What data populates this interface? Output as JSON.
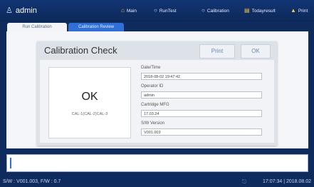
{
  "header": {
    "user": "admin",
    "nav": [
      {
        "label": "Main",
        "icon": "home-icon"
      },
      {
        "label": "RunTest",
        "icon": "runtest-icon"
      },
      {
        "label": "Calibration",
        "icon": "calibration-icon"
      },
      {
        "label": "Todayresult",
        "icon": "todayresult-icon"
      },
      {
        "label": "Print",
        "icon": "printer-icon"
      }
    ]
  },
  "tabs": [
    {
      "label": "Run Calibration",
      "selected": true
    },
    {
      "label": "Calibration Review",
      "selected": false
    }
  ],
  "dialog": {
    "title": "Calibration Check",
    "print_label": "Print",
    "ok_label": "OK",
    "result": "OK",
    "result_detail": "CAL-1(CAL-2)CAL-3",
    "fields": [
      {
        "label": "Date/Time",
        "value": "2018-08-02 19:47:42"
      },
      {
        "label": "Operator ID",
        "value": "admin"
      },
      {
        "label": "Cartridge MFG",
        "value": "17.03.24"
      },
      {
        "label": "S/W Version",
        "value": "V001.003"
      }
    ]
  },
  "footer": {
    "version": "S/W : V001.003, F/W : 0.7",
    "datetime": "17:07:34 | 2018.08.02"
  },
  "colors": {
    "background": "#0f2a5c",
    "accent": "#2f6fd6",
    "panel": "#f4f6f9"
  }
}
